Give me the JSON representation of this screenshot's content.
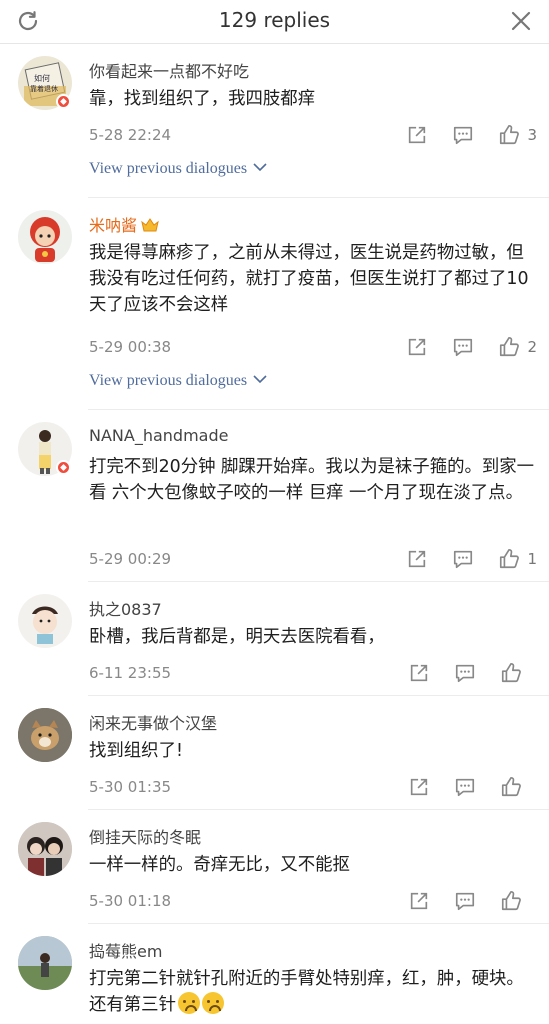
{
  "header": {
    "title": "129 replies"
  },
  "view_previous_label": "View previous dialogues",
  "comments": [
    {
      "username": "你看起来一点都不好吃",
      "text": "靠，找到组织了，我四肢都痒",
      "time": "5-28 22:24",
      "likes": "3",
      "avatar_text": "如何 靠着退休…",
      "colors": {
        "avatar": "#e8e2cf"
      }
    },
    {
      "username": "米呐酱",
      "text": "我是得荨麻疹了，之前从未得过，医生说是药物过敏，但我没有吃过任何药，就打了疫苗，但医生说打了都过了10天了应该不会这样",
      "time": "5-29 00:38",
      "likes": "2",
      "colors": {
        "name": "#e66a1a"
      }
    },
    {
      "username": "NANA_handmade",
      "text": "打完不到20分钟 脚踝开始痒。我以为是袜子箍的。到家一看 六个大包像蚊子咬的一样 巨痒  一个月了现在淡了点。",
      "time": "5-29 00:29",
      "likes": "1"
    },
    {
      "username": "执之0837",
      "text": "卧槽，我后背都是，明天去医院看看，",
      "time": "6-11 23:55",
      "likes": ""
    },
    {
      "username": "闲来无事做个汉堡",
      "text": "找到组织了!",
      "time": "5-30 01:35",
      "likes": ""
    },
    {
      "username": "倒挂天际的冬眠",
      "text": "一样一样的。奇痒无比，又不能抠",
      "time": "5-30 01:18",
      "likes": ""
    },
    {
      "username": "捣莓熊em",
      "text": "打完第二针就针孔附近的手臂处特别痒，红，肿，硬块。还有第三针",
      "time": "",
      "likes": ""
    }
  ],
  "icons": {
    "refresh": "refresh-icon",
    "close": "close-icon",
    "share": "share-icon",
    "comment": "comment-icon",
    "like": "thumbs-up-icon",
    "crown": "crown-icon",
    "emoji": "sad-face-emoji"
  }
}
